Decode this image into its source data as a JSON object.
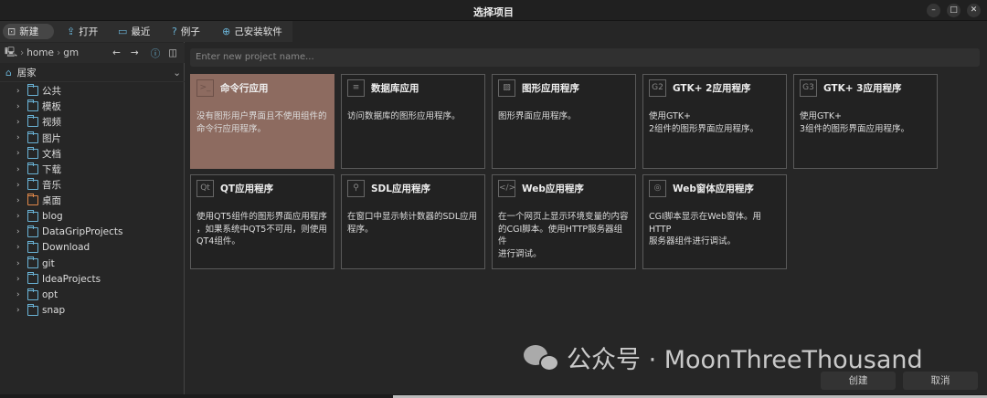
{
  "window": {
    "title": "选择项目",
    "minimize": "–",
    "maximize": "□",
    "close": "✕"
  },
  "toolbar": [
    {
      "label": "新建",
      "icon": "new-file-icon"
    },
    {
      "label": "打开",
      "icon": "open-folder-icon"
    },
    {
      "label": "最近",
      "icon": "recent-icon"
    },
    {
      "label": "例子",
      "icon": "question-icon"
    },
    {
      "label": "己安装软件",
      "icon": "download-icon"
    }
  ],
  "path": {
    "segments": [
      "home",
      "gm"
    ]
  },
  "places": {
    "current": "居家"
  },
  "tree": [
    {
      "label": "公共"
    },
    {
      "label": "模板"
    },
    {
      "label": "视频"
    },
    {
      "label": "图片"
    },
    {
      "label": "文档"
    },
    {
      "label": "下载"
    },
    {
      "label": "音乐"
    },
    {
      "label": "桌面",
      "desktop": true
    },
    {
      "label": "blog"
    },
    {
      "label": "DataGripProjects"
    },
    {
      "label": "Download"
    },
    {
      "label": "git"
    },
    {
      "label": "IdeaProjects"
    },
    {
      "label": "opt"
    },
    {
      "label": "snap"
    }
  ],
  "project_name": {
    "placeholder": "Enter new project name..."
  },
  "templates": [
    {
      "title": "命令行应用",
      "desc": "没有图形用户界面且不使用组件的\n命令行应用程序。",
      "icon": "terminal-icon",
      "glyph": ">_",
      "selected": true
    },
    {
      "title": "数据库应用",
      "desc": "访问数据库的图形应用程序。",
      "icon": "database-icon",
      "glyph": "≡"
    },
    {
      "title": "图形应用程序",
      "desc": "图形界面应用程序。",
      "icon": "image-icon",
      "glyph": "▨"
    },
    {
      "title": "GTK+ 2应用程序",
      "desc": "使用GTK+\n2组件的图形界面应用程序。",
      "icon": "gtk2-icon",
      "glyph": "G2"
    },
    {
      "title": "GTK+ 3应用程序",
      "desc": "使用GTK+\n3组件的图形界面应用程序。",
      "icon": "gtk3-icon",
      "glyph": "G3"
    },
    {
      "title": "QT应用程序",
      "desc": "使用QT5组件的图形界面应用程序\n，如果系统中QT5不可用，则使用\nQT4组件。",
      "icon": "qt-icon",
      "glyph": "Qt"
    },
    {
      "title": "SDL应用程序",
      "desc": "在窗口中显示帧计数器的SDL应用\n程序。",
      "icon": "stamp-icon",
      "glyph": "⚲"
    },
    {
      "title": "Web应用程序",
      "desc": "在一个网页上显示环境变量的内容\n的CGI脚本。使用HTTP服务器组件\n进行调试。",
      "icon": "code-icon",
      "glyph": "</>"
    },
    {
      "title": "Web窗体应用程序",
      "desc": "CGI脚本显示在Web窗体。用HTTP\n服务器组件进行调试。",
      "icon": "webform-icon",
      "glyph": "◎"
    }
  ],
  "buttons": {
    "create": "创建",
    "cancel": "取消"
  },
  "watermark": "公众号 · MoonThreeThousand"
}
